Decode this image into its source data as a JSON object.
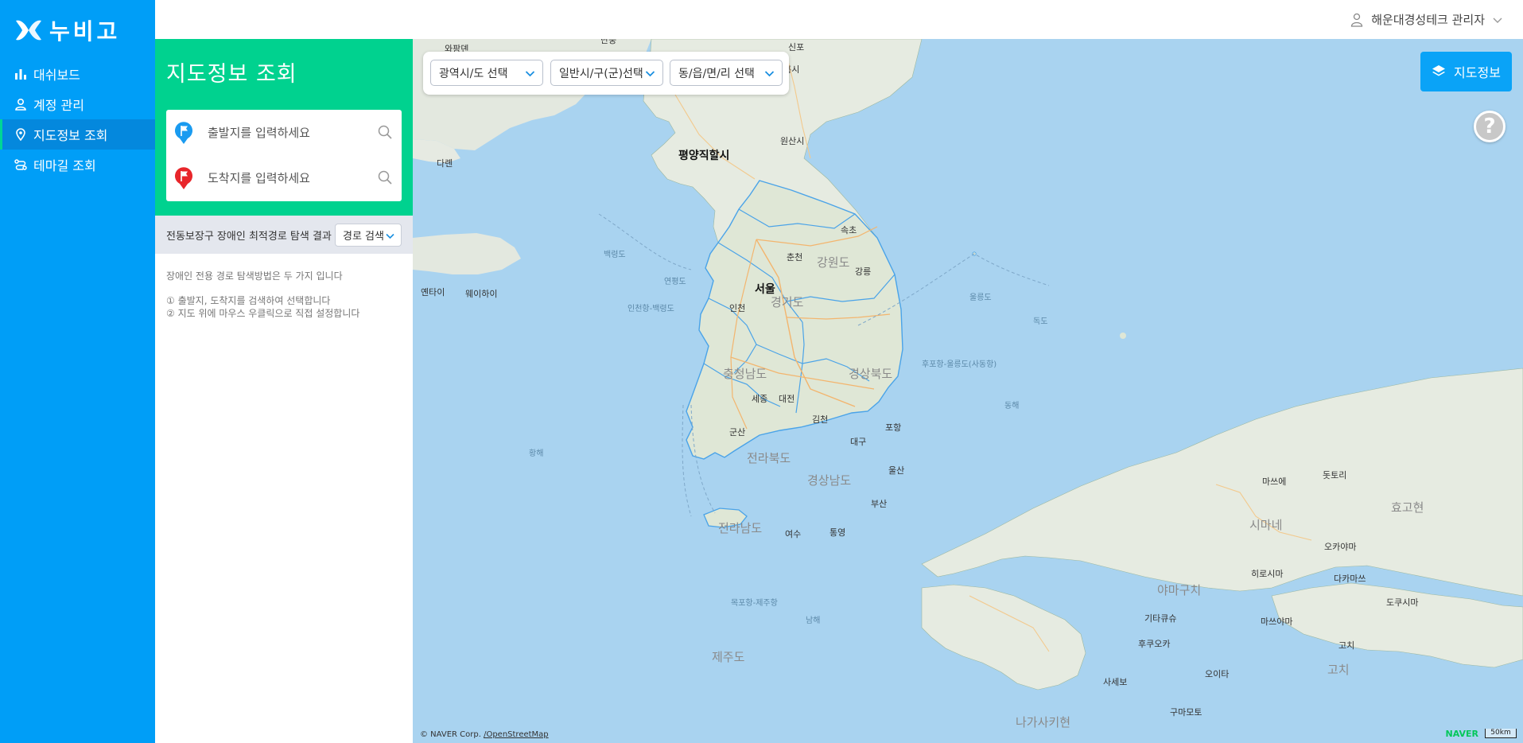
{
  "brand": {
    "name": "누비고"
  },
  "nav": {
    "items": [
      {
        "label": "대쉬보드",
        "icon": "bar-chart-icon",
        "active": false
      },
      {
        "label": "계정 관리",
        "icon": "user-icon",
        "active": false
      },
      {
        "label": "지도정보 조회",
        "icon": "location-pin-icon",
        "active": true
      },
      {
        "label": "테마길 조회",
        "icon": "route-icon",
        "active": false
      }
    ]
  },
  "header": {
    "user_label": "해운대경성테크 관리자"
  },
  "panel": {
    "title": "지도정보 조회",
    "origin_placeholder": "출발지를 입력하세요",
    "destination_placeholder": "도착지를 입력하세요",
    "result_label": "전동보장구 장애인 최적경로 탐색 결과",
    "route_search_label": "경로 검색",
    "guide_title": "장애인 전용 경로 탐색방법은 두 가지 입니다",
    "guide_1": "① 출발지, 도착지를 검색하여 선택합니다",
    "guide_2": "② 지도 위에 마우스 우클릭으로 직접 설정합니다"
  },
  "map": {
    "filters": {
      "province": "광역시/도 선택",
      "city": "일반시/구(군)선택",
      "town": "동/읍/면/리 선택"
    },
    "info_button": "지도정보",
    "help_button": "?",
    "attribution_corp": "© NAVER Corp.",
    "attribution_osm": "/OpenStreetMap",
    "provider_logo": "NAVER",
    "scale_label": "50km",
    "labels": {
      "dandong": "단둥",
      "wabangdian": "와팡뎬",
      "dalian": "다롄",
      "pyongyang": "평양직할시",
      "sinpo": "신포",
      "wonsan": "원산시",
      "hamhung": "함흥시",
      "sokcho": "속초",
      "chuncheon": "춘천",
      "gangwon": "강원도",
      "gangneung": "강릉",
      "seoul": "서울",
      "incheon": "인천",
      "gyeonggi": "경기도",
      "chungnam": "충청남도",
      "gyeongbuk": "경상북도",
      "sejong": "세종",
      "daejeon": "대전",
      "gimcheon": "김천",
      "pohang": "포항",
      "gunsan": "군산",
      "daegu": "대구",
      "jeonbuk": "전라북도",
      "ulsan": "울산",
      "gyeongnam": "경상남도",
      "busan": "부산",
      "jeonnam": "전라남도",
      "yeosu": "여수",
      "tongyeong": "통영",
      "jeju": "제주도",
      "yantai": "옌타이",
      "weihai": "웨이하이",
      "baengnyeong": "백령도",
      "yeonpyeong": "연평도",
      "ulleung": "울릉도",
      "dokdo": "독도",
      "east_sea": "동해",
      "yellow_sea": "황해",
      "south_sea": "남해",
      "shimane": "시마네",
      "yamaguchi": "야마구치",
      "kitakyushu": "기타큐슈",
      "fukuoka": "후쿠오카",
      "hiroshima": "히로시마",
      "okayama": "오카야마",
      "matsue": "마쓰에",
      "tottori": "돗토리",
      "hyogo": "효고현",
      "takamatsu": "다카마쓰",
      "tokushima": "도쿠시마",
      "matsuyama": "마쓰야마",
      "kochi": "고치",
      "kochi_pref": "고치",
      "oita": "오이타",
      "sasebo": "사세보",
      "kumamoto": "구마모토",
      "nagasaki": "나가사키현",
      "seaway_a": "인천항-백령도",
      "seaway_b": "목포항-제주항",
      "seaway_c": "후포항-울릉도(사동항)"
    }
  }
}
